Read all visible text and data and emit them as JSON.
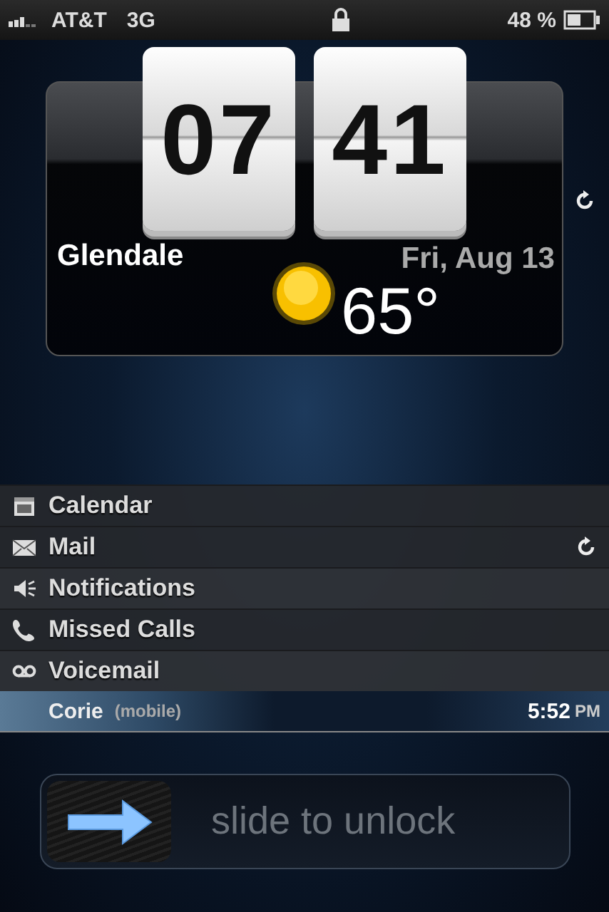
{
  "status_bar": {
    "carrier": "AT&T",
    "network": "3G",
    "battery": "48 %"
  },
  "widget": {
    "hour": "07",
    "minute": "41",
    "city": "Glendale",
    "date": "Fri, Aug 13",
    "temperature": "65°"
  },
  "sections": [
    {
      "kind": "calendar",
      "label": "Calendar",
      "refresh": false
    },
    {
      "kind": "mail",
      "label": "Mail",
      "refresh": true
    },
    {
      "kind": "notifications",
      "label": "Notifications",
      "refresh": false
    },
    {
      "kind": "calls",
      "label": "Missed Calls",
      "refresh": false
    },
    {
      "kind": "voicemail",
      "label": "Voicemail",
      "refresh": false
    }
  ],
  "voicemails": [
    {
      "name": "Corie",
      "type": "(mobile)",
      "time": "5:52",
      "period": "PM"
    }
  ],
  "slider": {
    "label": "slide to unlock",
    "level": 0
  }
}
